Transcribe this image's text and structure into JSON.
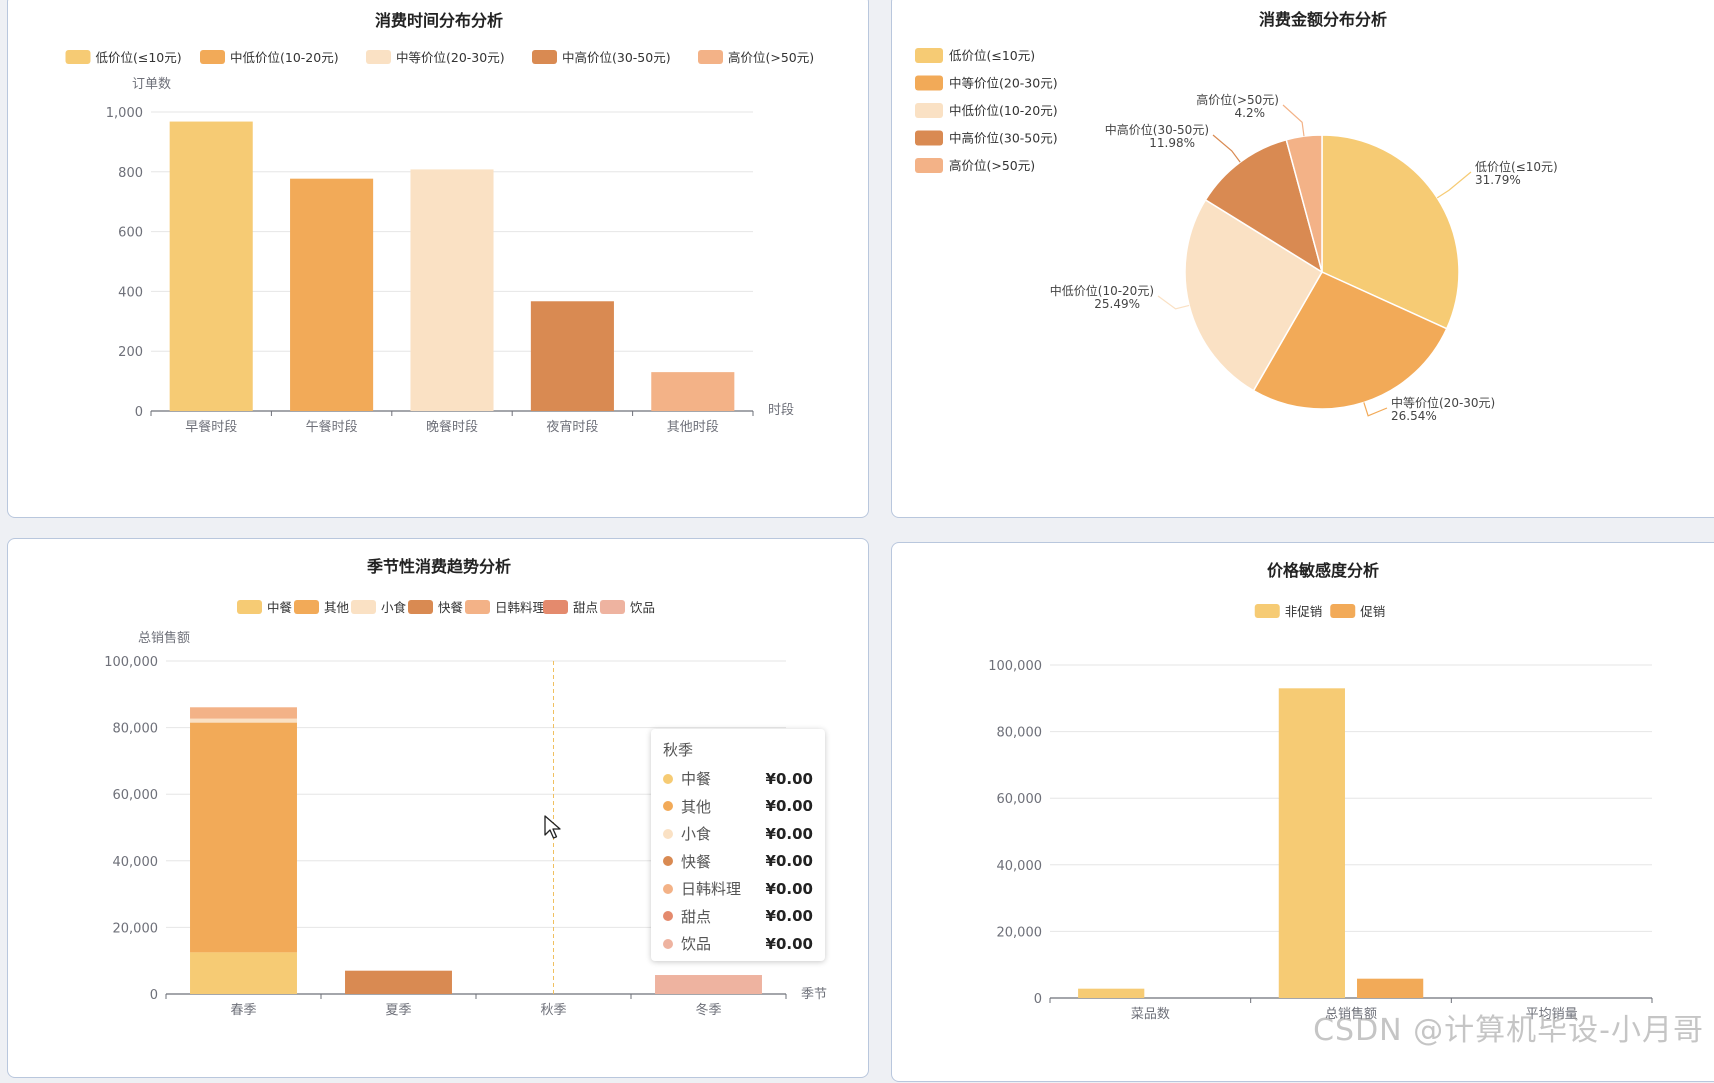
{
  "colors": {
    "c1": "#f6cb74",
    "c2": "#f2aa58",
    "c3": "#fae1c4",
    "c4": "#d98a52",
    "c5": "#f3b287",
    "c6": "#e48a6d",
    "c7": "#eeb3a0",
    "axis": "#6e7079",
    "grid": "#e6e6e6",
    "title": "#222222"
  },
  "chart_data": [
    {
      "id": "time",
      "type": "bar",
      "title": "消费时间分布分析",
      "legend": [
        "低价位(≤10元)",
        "中低价位(10-20元)",
        "中等价位(20-30元)",
        "中高价位(30-50元)",
        "高价位(>50元)"
      ],
      "ylabel": "订单数",
      "xlabel": "时段",
      "categories": [
        "早餐时段",
        "午餐时段",
        "晚餐时段",
        "夜宵时段",
        "其他时段"
      ],
      "values": [
        968,
        777,
        808,
        367,
        130
      ],
      "bar_colors": [
        "#f6cb74",
        "#f2aa58",
        "#fae1c4",
        "#d98a52",
        "#f3b287"
      ],
      "ylim": [
        0,
        1000
      ],
      "yticks": [
        "0",
        "200",
        "400",
        "600",
        "800",
        "1,000"
      ],
      "grid": true,
      "legend_position": "top"
    },
    {
      "id": "amount",
      "type": "pie",
      "title": "消费金额分布分析",
      "legend": [
        "低价位(≤10元)",
        "中等价位(20-30元)",
        "中低价位(10-20元)",
        "中高价位(30-50元)",
        "高价位(>50元)"
      ],
      "legend_position": "left",
      "slices": [
        {
          "label": "低价位(≤10元)",
          "percent": "31.79%",
          "value": 31.79
        },
        {
          "label": "中等价位(20-30元)",
          "percent": "26.54%",
          "value": 26.54
        },
        {
          "label": "中低价位(10-20元)",
          "percent": "25.49%",
          "value": 25.49
        },
        {
          "label": "中高价位(30-50元)",
          "percent": "11.98%",
          "value": 11.98
        },
        {
          "label": "高价位(>50元)",
          "percent": "4.2%",
          "value": 4.2
        }
      ]
    },
    {
      "id": "season",
      "type": "bar",
      "stacked": true,
      "title": "季节性消费趋势分析",
      "ylabel": "总销售额",
      "xlabel": "季节",
      "categories": [
        "春季",
        "夏季",
        "秋季",
        "冬季"
      ],
      "ylim": [
        0,
        100000
      ],
      "yticks": [
        "0",
        "20,000",
        "40,000",
        "60,000",
        "80,000",
        "100,000"
      ],
      "grid": true,
      "legend_position": "top",
      "series": [
        {
          "name": "中餐",
          "values": [
            12500,
            0,
            0,
            0
          ]
        },
        {
          "name": "其他",
          "values": [
            69000,
            0,
            0,
            0
          ]
        },
        {
          "name": "小食",
          "values": [
            1200,
            0,
            0,
            0
          ]
        },
        {
          "name": "快餐",
          "values": [
            0,
            7000,
            0,
            0
          ]
        },
        {
          "name": "日韩料理",
          "values": [
            3400,
            0,
            0,
            0
          ]
        },
        {
          "name": "甜点",
          "values": [
            0,
            0,
            0,
            0
          ]
        },
        {
          "name": "饮品",
          "values": [
            0,
            0,
            0,
            5700
          ]
        }
      ],
      "tooltip": {
        "title": "秋季",
        "rows": [
          {
            "name": "中餐",
            "value": "¥0.00"
          },
          {
            "name": "其他",
            "value": "¥0.00"
          },
          {
            "name": "小食",
            "value": "¥0.00"
          },
          {
            "name": "快餐",
            "value": "¥0.00"
          },
          {
            "name": "日韩料理",
            "value": "¥0.00"
          },
          {
            "name": "甜点",
            "value": "¥0.00"
          },
          {
            "name": "饮品",
            "value": "¥0.00"
          }
        ]
      }
    },
    {
      "id": "price",
      "type": "bar",
      "title": "价格敏感度分析",
      "categories": [
        "菜品数",
        "总销售额",
        "平均销量"
      ],
      "ylim": [
        0,
        100000
      ],
      "yticks": [
        "0",
        "20,000",
        "40,000",
        "60,000",
        "80,000",
        "100,000"
      ],
      "grid": true,
      "legend_position": "top",
      "series": [
        {
          "name": "非促销",
          "values": [
            2800,
            93000,
            0
          ]
        },
        {
          "name": "促销",
          "values": [
            0,
            5800,
            0
          ]
        }
      ]
    }
  ],
  "watermark": "CSDN @计算机毕设-小月哥"
}
